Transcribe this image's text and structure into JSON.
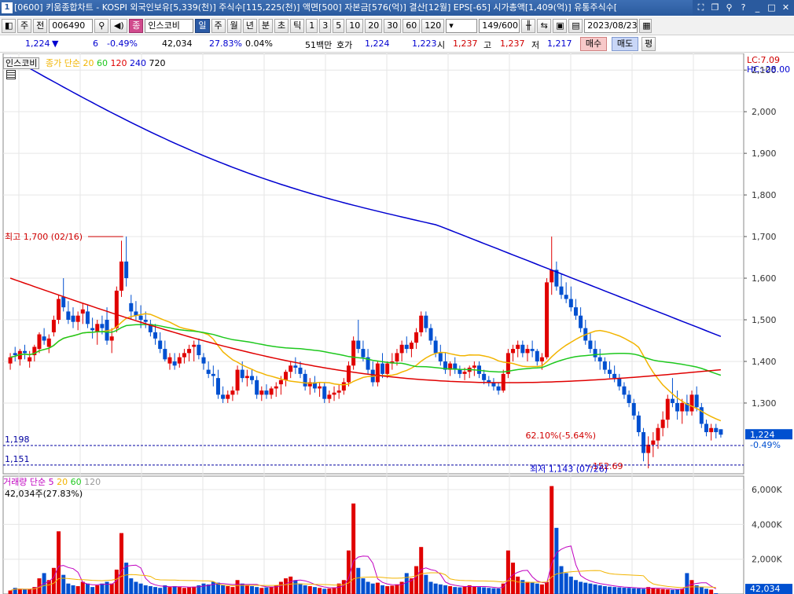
{
  "titlebar": {
    "window_number": "1",
    "text": "[0600] 키움종합차트 - KOSPI 외국인보유[5,339(천)] 주식수[115,225(천)] 액면[500] 자본금[576(억)] 결산[12월] EPS[-65] 시가총액[1,409(억)] 유통주식수[",
    "icons": [
      "window-link-icon",
      "window-restore-icon",
      "pin-icon",
      "help-icon",
      "minimize-icon",
      "maximize-icon",
      "close-icon"
    ]
  },
  "toolbar": {
    "market_label": "주",
    "prev_label": "전",
    "stock_code": "006490",
    "stock_tag": "종",
    "stock_name": "인스코비",
    "periods": [
      "일",
      "주",
      "월",
      "년",
      "분",
      "초",
      "틱"
    ],
    "selected_period": "일",
    "intervals": [
      "1",
      "3",
      "5",
      "10",
      "20",
      "30",
      "60",
      "120"
    ],
    "count": "149/600",
    "date": "2023/08/23"
  },
  "quote": {
    "price": "1,224",
    "direction": "▼",
    "change": "6",
    "change_pct": "-0.49%",
    "volume": "42,034",
    "volume_ratio": "27.83%",
    "turnover": "0.04%",
    "amount": "51백만",
    "bid_label": "호가",
    "bid": "1,224",
    "ask": "1,223",
    "open_label": "시",
    "open": "1,237",
    "high_label": "고",
    "high": "1,237",
    "low_label": "저",
    "low": "1,217",
    "buy_label": "매수",
    "sell_label": "매도",
    "avg_label": "평"
  },
  "price_legend": {
    "name": "인스코비",
    "ma_label": "종가 단순",
    "periods": [
      "20",
      "60",
      "120",
      "240",
      "720"
    ],
    "colors": [
      "#f2b400",
      "#1ec81e",
      "#e00000",
      "#0000d0",
      "#000000"
    ]
  },
  "price_axis": {
    "lc": "LC:7.09",
    "hc": "HC:-28.00",
    "ticks": [
      "2,100",
      "2,000",
      "1,900",
      "1,800",
      "1,700",
      "1,600",
      "1,500",
      "1,400",
      "1,300"
    ],
    "current": "1,224",
    "current_pct": "-0.49%"
  },
  "annotations": {
    "high": "최고 1,700 (02/16)",
    "low": "최저 1,143 (07/26)",
    "change": "62.10%(-5.64%)",
    "low_change": "-152.69",
    "line1": "1,198",
    "line2": "1,151"
  },
  "volume_legend": {
    "name": "거래량",
    "ma_label": "단순",
    "periods": [
      "5",
      "20",
      "60",
      "120"
    ],
    "colors": [
      "#c000c0",
      "#f2b400",
      "#1ec81e",
      "#999999"
    ],
    "value": "42,034주(27.83%)"
  },
  "volume_axis": {
    "ticks": [
      "6,000K",
      "4,000K",
      "2,000K"
    ],
    "current": "42,034",
    "current_pct": "27.83%"
  },
  "chart_data": {
    "type": "candlestick",
    "y_range": [
      1130,
      2140
    ],
    "volume_range_k": [
      0,
      6500
    ],
    "ohlc": [
      [
        1395,
        1420,
        1380,
        1410
      ],
      [
        1420,
        1435,
        1400,
        1415
      ],
      [
        1405,
        1430,
        1390,
        1425
      ],
      [
        1425,
        1440,
        1405,
        1420
      ],
      [
        1400,
        1425,
        1385,
        1410
      ],
      [
        1415,
        1440,
        1400,
        1435
      ],
      [
        1430,
        1470,
        1420,
        1465
      ],
      [
        1460,
        1480,
        1440,
        1450
      ],
      [
        1435,
        1465,
        1420,
        1455
      ],
      [
        1470,
        1510,
        1460,
        1500
      ],
      [
        1500,
        1560,
        1490,
        1550
      ],
      [
        1555,
        1600,
        1520,
        1530
      ],
      [
        1520,
        1545,
        1490,
        1500
      ],
      [
        1510,
        1530,
        1480,
        1495
      ],
      [
        1495,
        1520,
        1475,
        1510
      ],
      [
        1515,
        1540,
        1490,
        1525
      ],
      [
        1520,
        1535,
        1480,
        1490
      ],
      [
        1480,
        1505,
        1455,
        1475
      ],
      [
        1470,
        1500,
        1440,
        1490
      ],
      [
        1490,
        1510,
        1465,
        1480
      ],
      [
        1500,
        1530,
        1440,
        1450
      ],
      [
        1450,
        1480,
        1420,
        1460
      ],
      [
        1480,
        1580,
        1470,
        1570
      ],
      [
        1570,
        1690,
        1555,
        1640
      ],
      [
        1640,
        1700,
        1580,
        1600
      ],
      [
        1540,
        1560,
        1500,
        1520
      ],
      [
        1520,
        1545,
        1500,
        1510
      ],
      [
        1510,
        1535,
        1480,
        1500
      ],
      [
        1500,
        1520,
        1480,
        1495
      ],
      [
        1490,
        1500,
        1460,
        1470
      ],
      [
        1470,
        1490,
        1440,
        1455
      ],
      [
        1450,
        1470,
        1420,
        1430
      ],
      [
        1430,
        1450,
        1400,
        1405
      ],
      [
        1395,
        1420,
        1380,
        1410
      ],
      [
        1400,
        1420,
        1380,
        1390
      ],
      [
        1395,
        1420,
        1385,
        1410
      ],
      [
        1410,
        1430,
        1395,
        1420
      ],
      [
        1420,
        1440,
        1400,
        1430
      ],
      [
        1435,
        1450,
        1400,
        1440
      ],
      [
        1440,
        1455,
        1405,
        1415
      ],
      [
        1410,
        1420,
        1380,
        1395
      ],
      [
        1380,
        1400,
        1360,
        1370
      ],
      [
        1370,
        1390,
        1340,
        1365
      ],
      [
        1360,
        1380,
        1310,
        1320
      ],
      [
        1320,
        1340,
        1300,
        1310
      ],
      [
        1310,
        1330,
        1300,
        1320
      ],
      [
        1320,
        1340,
        1305,
        1330
      ],
      [
        1330,
        1390,
        1320,
        1380
      ],
      [
        1380,
        1400,
        1350,
        1360
      ],
      [
        1360,
        1380,
        1340,
        1365
      ],
      [
        1365,
        1380,
        1345,
        1355
      ],
      [
        1355,
        1365,
        1310,
        1320
      ],
      [
        1320,
        1340,
        1305,
        1330
      ],
      [
        1330,
        1345,
        1310,
        1320
      ],
      [
        1320,
        1340,
        1310,
        1335
      ],
      [
        1335,
        1350,
        1315,
        1340
      ],
      [
        1345,
        1365,
        1320,
        1355
      ],
      [
        1355,
        1380,
        1340,
        1375
      ],
      [
        1375,
        1400,
        1360,
        1390
      ],
      [
        1390,
        1410,
        1370,
        1385
      ],
      [
        1385,
        1400,
        1360,
        1370
      ],
      [
        1370,
        1380,
        1330,
        1340
      ],
      [
        1340,
        1360,
        1320,
        1350
      ],
      [
        1350,
        1365,
        1325,
        1335
      ],
      [
        1335,
        1350,
        1315,
        1340
      ],
      [
        1340,
        1350,
        1300,
        1310
      ],
      [
        1310,
        1330,
        1300,
        1320
      ],
      [
        1320,
        1340,
        1305,
        1325
      ],
      [
        1325,
        1345,
        1310,
        1330
      ],
      [
        1330,
        1360,
        1320,
        1350
      ],
      [
        1350,
        1400,
        1340,
        1390
      ],
      [
        1390,
        1460,
        1380,
        1450
      ],
      [
        1450,
        1500,
        1420,
        1430
      ],
      [
        1430,
        1450,
        1400,
        1410
      ],
      [
        1410,
        1430,
        1370,
        1380
      ],
      [
        1380,
        1400,
        1340,
        1350
      ],
      [
        1350,
        1400,
        1340,
        1395
      ],
      [
        1395,
        1420,
        1360,
        1370
      ],
      [
        1370,
        1400,
        1360,
        1395
      ],
      [
        1395,
        1420,
        1380,
        1400
      ],
      [
        1400,
        1430,
        1390,
        1420
      ],
      [
        1420,
        1450,
        1400,
        1440
      ],
      [
        1440,
        1460,
        1420,
        1430
      ],
      [
        1430,
        1450,
        1410,
        1445
      ],
      [
        1445,
        1480,
        1430,
        1470
      ],
      [
        1470,
        1520,
        1460,
        1510
      ],
      [
        1510,
        1520,
        1470,
        1480
      ],
      [
        1480,
        1490,
        1440,
        1450
      ],
      [
        1450,
        1460,
        1410,
        1420
      ],
      [
        1420,
        1440,
        1390,
        1400
      ],
      [
        1400,
        1420,
        1370,
        1380
      ],
      [
        1380,
        1400,
        1365,
        1395
      ],
      [
        1395,
        1410,
        1370,
        1380
      ],
      [
        1380,
        1390,
        1360,
        1370
      ],
      [
        1370,
        1385,
        1355,
        1375
      ],
      [
        1375,
        1390,
        1360,
        1385
      ],
      [
        1385,
        1400,
        1365,
        1390
      ],
      [
        1390,
        1400,
        1360,
        1370
      ],
      [
        1370,
        1380,
        1345,
        1355
      ],
      [
        1355,
        1365,
        1340,
        1350
      ],
      [
        1350,
        1360,
        1330,
        1340
      ],
      [
        1340,
        1350,
        1320,
        1330
      ],
      [
        1330,
        1380,
        1325,
        1370
      ],
      [
        1370,
        1430,
        1360,
        1420
      ],
      [
        1420,
        1440,
        1400,
        1430
      ],
      [
        1430,
        1450,
        1410,
        1440
      ],
      [
        1440,
        1450,
        1410,
        1420
      ],
      [
        1420,
        1440,
        1400,
        1430
      ],
      [
        1430,
        1450,
        1410,
        1425
      ],
      [
        1425,
        1430,
        1390,
        1400
      ],
      [
        1400,
        1420,
        1380,
        1410
      ],
      [
        1410,
        1600,
        1405,
        1590
      ],
      [
        1590,
        1700,
        1560,
        1620
      ],
      [
        1620,
        1640,
        1570,
        1580
      ],
      [
        1580,
        1610,
        1550,
        1560
      ],
      [
        1560,
        1590,
        1540,
        1550
      ],
      [
        1550,
        1580,
        1520,
        1530
      ],
      [
        1530,
        1550,
        1500,
        1510
      ],
      [
        1510,
        1530,
        1470,
        1480
      ],
      [
        1480,
        1500,
        1440,
        1450
      ],
      [
        1450,
        1470,
        1420,
        1430
      ],
      [
        1430,
        1450,
        1400,
        1410
      ],
      [
        1410,
        1430,
        1380,
        1400
      ],
      [
        1400,
        1410,
        1370,
        1380
      ],
      [
        1380,
        1400,
        1360,
        1370
      ],
      [
        1370,
        1390,
        1350,
        1360
      ],
      [
        1360,
        1370,
        1330,
        1340
      ],
      [
        1340,
        1350,
        1310,
        1320
      ],
      [
        1320,
        1330,
        1290,
        1300
      ],
      [
        1300,
        1310,
        1260,
        1270
      ],
      [
        1270,
        1280,
        1220,
        1230
      ],
      [
        1230,
        1240,
        1160,
        1180
      ],
      [
        1180,
        1220,
        1143,
        1200
      ],
      [
        1200,
        1230,
        1170,
        1210
      ],
      [
        1210,
        1250,
        1190,
        1240
      ],
      [
        1240,
        1280,
        1220,
        1260
      ],
      [
        1260,
        1320,
        1240,
        1310
      ],
      [
        1310,
        1360,
        1290,
        1300
      ],
      [
        1300,
        1330,
        1260,
        1280
      ],
      [
        1280,
        1310,
        1250,
        1300
      ],
      [
        1300,
        1320,
        1270,
        1280
      ],
      [
        1280,
        1330,
        1270,
        1320
      ],
      [
        1320,
        1340,
        1280,
        1290
      ],
      [
        1290,
        1300,
        1240,
        1250
      ],
      [
        1250,
        1260,
        1220,
        1230
      ],
      [
        1230,
        1250,
        1210,
        1240
      ],
      [
        1240,
        1250,
        1215,
        1230
      ],
      [
        1237,
        1237,
        1217,
        1224
      ]
    ],
    "volume_k": [
      200,
      350,
      300,
      250,
      280,
      400,
      900,
      1200,
      800,
      1500,
      3600,
      1100,
      600,
      500,
      450,
      700,
      600,
      400,
      500,
      600,
      700,
      600,
      1400,
      3500,
      1800,
      900,
      700,
      600,
      500,
      450,
      400,
      350,
      500,
      400,
      450,
      400,
      350,
      380,
      420,
      500,
      600,
      550,
      700,
      650,
      500,
      450,
      400,
      800,
      600,
      500,
      450,
      400,
      350,
      380,
      420,
      500,
      700,
      900,
      1000,
      800,
      600,
      500,
      450,
      400,
      350,
      300,
      320,
      380,
      600,
      800,
      2500,
      5200,
      1500,
      900,
      700,
      600,
      650,
      500,
      450,
      480,
      550,
      700,
      1200,
      900,
      1600,
      2700,
      1100,
      700,
      600,
      550,
      500,
      450,
      400,
      380,
      420,
      500,
      450,
      400,
      380,
      350,
      330,
      320,
      600,
      2500,
      1800,
      1000,
      800,
      700,
      650,
      600,
      550,
      700,
      6200,
      3800,
      1600,
      1200,
      1000,
      800,
      700,
      650,
      600,
      550,
      500,
      450,
      420,
      400,
      380,
      360,
      350,
      330,
      320,
      300,
      400,
      350,
      300,
      280,
      260,
      240,
      250,
      300,
      1200,
      800,
      500,
      400,
      300,
      250,
      42
    ]
  }
}
